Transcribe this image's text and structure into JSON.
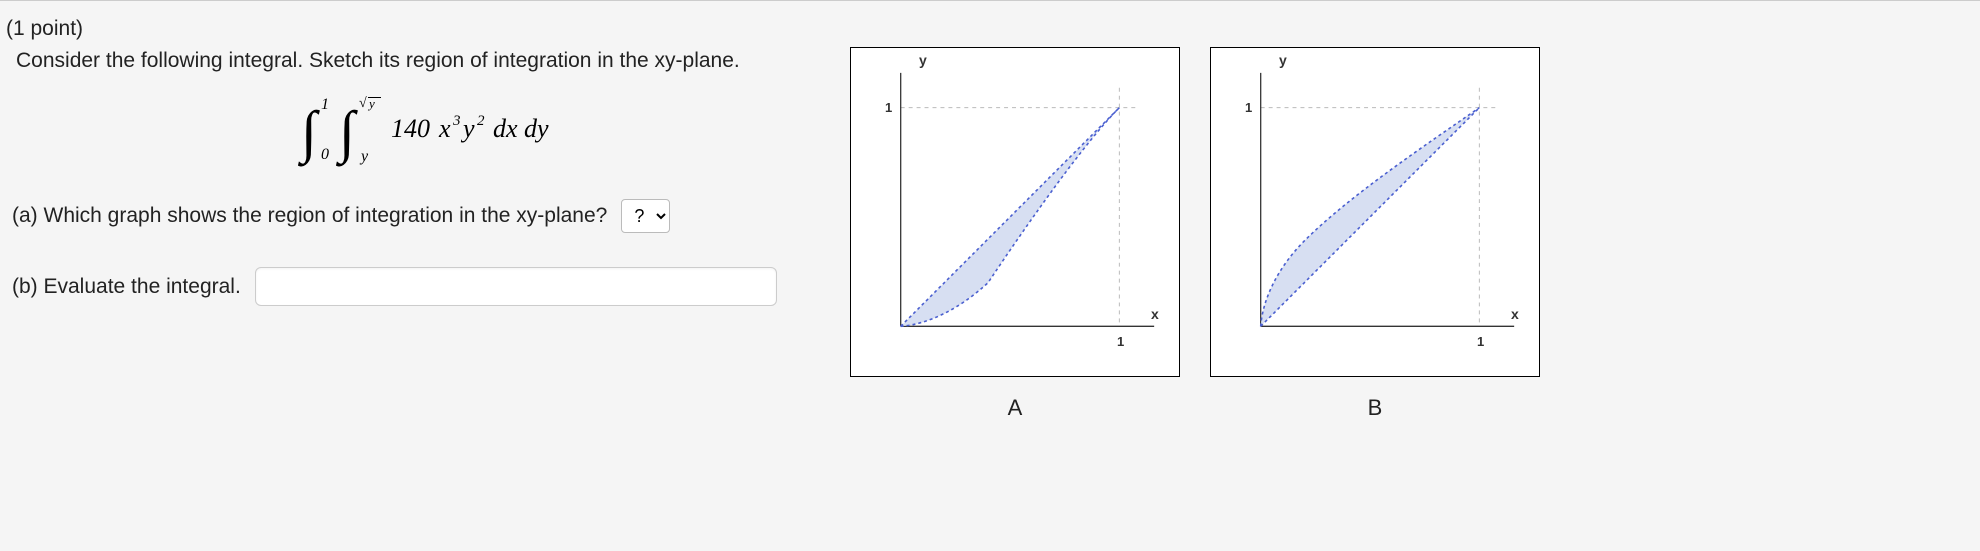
{
  "points_label": "(1 point)",
  "prompt": "Consider the following integral. Sketch its region of integration in the xy-plane.",
  "parts": {
    "a": {
      "label": "(a) Which graph shows the region of integration in the xy-plane?",
      "dropdown_placeholder": "?"
    },
    "b": {
      "label": "(b) Evaluate the integral.",
      "value": ""
    }
  },
  "integral": {
    "display": "∫₀¹ ∫ᵧ^√y 140 x³ y² dx dy",
    "outer_lower": "0",
    "outer_upper": "1",
    "inner_lower": "y",
    "inner_upper": "√y",
    "integrand": "140x³y²",
    "differentials": "dx dy"
  },
  "figures": {
    "A": {
      "label": "A",
      "y_axis": "y",
      "x_axis": "x",
      "y_tick": "1",
      "x_tick": "1"
    },
    "B": {
      "label": "B",
      "y_axis": "y",
      "x_axis": "x",
      "y_tick": "1",
      "x_tick": "1"
    }
  },
  "chart_data": [
    {
      "type": "area",
      "id": "A",
      "title": "Region A",
      "xlabel": "x",
      "ylabel": "y",
      "xlim": [
        0,
        1.15
      ],
      "ylim": [
        0,
        1.15
      ],
      "description": "Region between y=x and y=x^2 for 0≤x≤1 (above y=x^2, below y=x).",
      "boundary_curves": [
        {
          "name": "y = x",
          "x": [
            0,
            1
          ],
          "y": [
            0,
            1
          ]
        },
        {
          "name": "y = x^2",
          "x": [
            0,
            0.25,
            0.5,
            0.75,
            1
          ],
          "y": [
            0,
            0.0625,
            0.25,
            0.5625,
            1
          ]
        }
      ]
    },
    {
      "type": "area",
      "id": "B",
      "title": "Region B",
      "xlabel": "x",
      "ylabel": "y",
      "xlim": [
        0,
        1.15
      ],
      "ylim": [
        0,
        1.15
      ],
      "description": "Region between y=x and y=√x for 0≤x≤1 (above y=x, below y=√x).",
      "boundary_curves": [
        {
          "name": "y = x",
          "x": [
            0,
            1
          ],
          "y": [
            0,
            1
          ]
        },
        {
          "name": "y = sqrt(x)",
          "x": [
            0,
            0.0625,
            0.25,
            0.5625,
            1
          ],
          "y": [
            0,
            0.25,
            0.5,
            0.75,
            1
          ]
        }
      ]
    }
  ]
}
